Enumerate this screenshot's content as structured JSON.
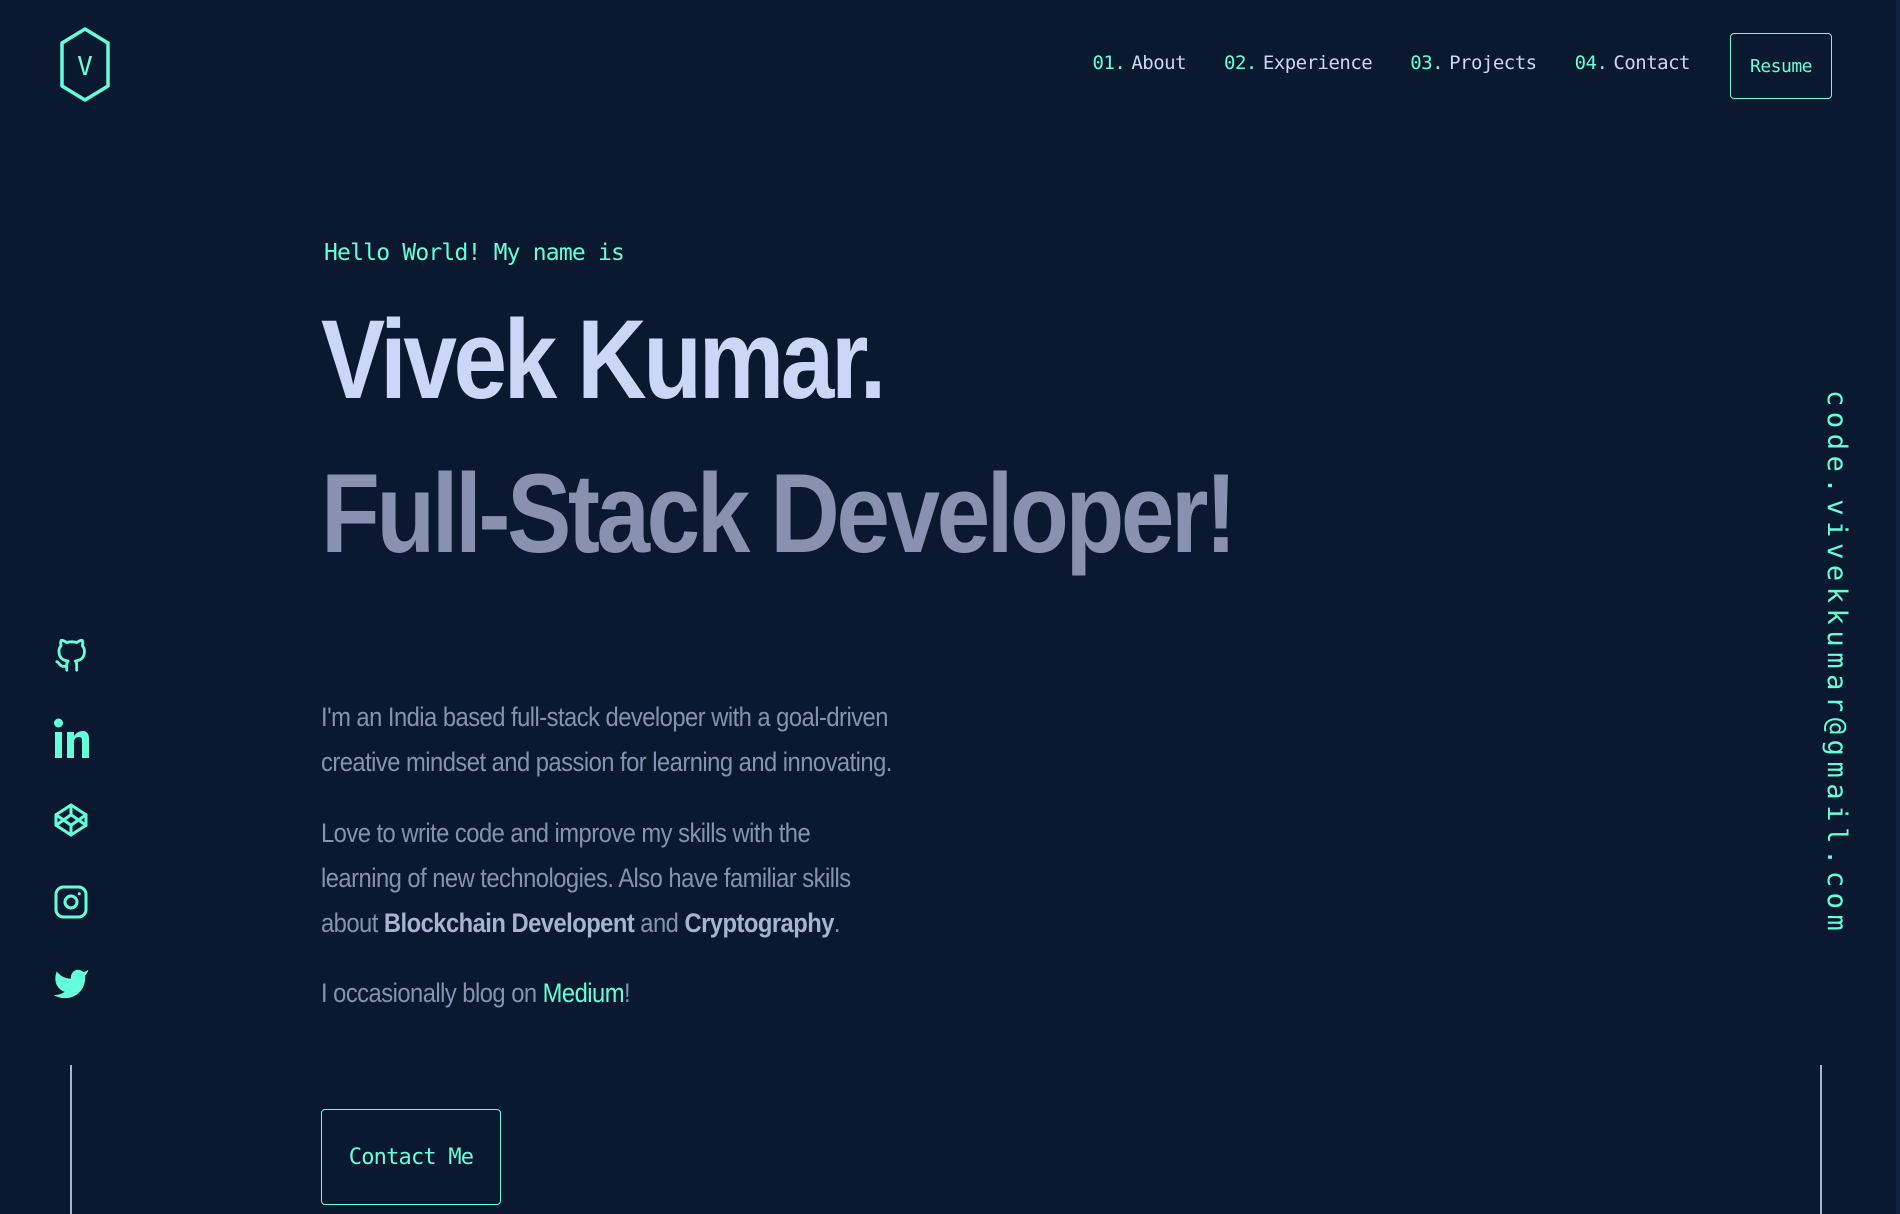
{
  "header": {
    "logo_letter": "V",
    "nav": [
      {
        "num": "01.",
        "label": "About"
      },
      {
        "num": "02.",
        "label": "Experience"
      },
      {
        "num": "03.",
        "label": "Projects"
      },
      {
        "num": "04.",
        "label": "Contact"
      }
    ],
    "resume_label": "Resume"
  },
  "hero": {
    "greeting": "Hello World! My name is",
    "name": "Vivek Kumar.",
    "role": "Full-Stack Developer!",
    "p1": "I'm an India based full-stack developer with a goal-driven creative mindset and passion for learning and innovating.",
    "p2_a": "Love to write code and improve my skills with the learning of new technologies. Also have familiar skills about ",
    "p2_b": "Blockchain Developent",
    "p2_c": " and ",
    "p2_d": "Cryptography",
    "p2_e": ".",
    "p3_a": "I occasionally blog on ",
    "p3_link": "Medium",
    "p3_b": "!",
    "contact_label": "Contact Me"
  },
  "social": [
    "github-icon",
    "linkedin-icon",
    "codepen-icon",
    "instagram-icon",
    "twitter-icon"
  ],
  "email": "code.vivekkumar@gmail.com",
  "colors": {
    "background": "#0a192f",
    "accent": "#64ffda",
    "heading": "#ccd6f6",
    "text": "#8892b0"
  }
}
